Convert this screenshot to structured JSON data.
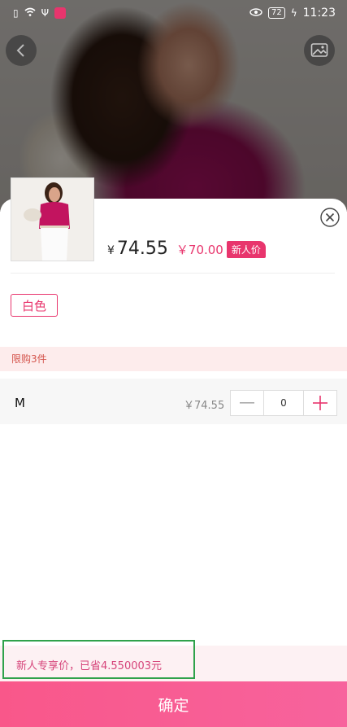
{
  "status_bar": {
    "time": "11:23",
    "battery": "72",
    "left_icons": [
      "sim-icon",
      "wifi-icon",
      "usb-icon",
      "app-icon"
    ],
    "right_icons": [
      "eye-icon",
      "battery-icon",
      "charging-icon"
    ]
  },
  "product": {
    "price_symbol": "¥",
    "price": "74.55",
    "new_user_price": "￥70.00",
    "new_user_badge": "新人价"
  },
  "spec": {
    "color_option": "白色"
  },
  "limit": {
    "text": "限购3件"
  },
  "item": {
    "size": "M",
    "price": "￥74.55",
    "quantity": "0"
  },
  "saving": {
    "text": "新人专享价，已省4.550003元"
  },
  "confirm": {
    "label": "确定"
  },
  "colors": {
    "accent": "#e8356d",
    "limit_bg": "#fdecec",
    "confirm_start": "#f9578a",
    "confirm_end": "#f7639d",
    "highlight": "#2fa24b"
  }
}
